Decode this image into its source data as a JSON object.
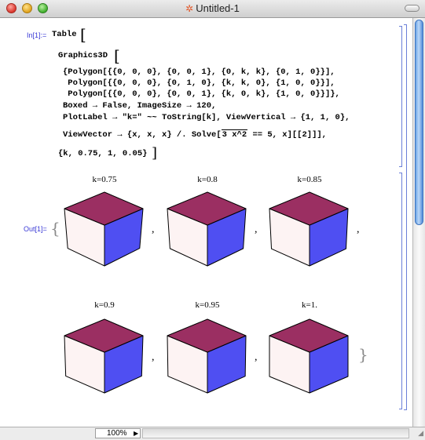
{
  "window": {
    "title": "Untitled-1"
  },
  "cells": {
    "input_label": "In[1]:=",
    "output_label": "Out[1]=",
    "code_lines": [
      "Table",
      "Graphics3D",
      "{Polygon[{{0, 0, 0}, {0, 0, 1}, {0, k, k}, {0, 1, 0}}],",
      " Polygon[{{0, 0, 0}, {0, 1, 0}, {k, k, 0}, {1, 0, 0}}],",
      " Polygon[{{0, 0, 0}, {0, 0, 1}, {k, 0, k}, {1, 0, 0}}]},",
      "Boxed → False, ImageSize → 120,",
      "PlotLabel → \"k=\" ~~ ToString[k], ViewVertical → {1, 1, 0},",
      "ViewVector → {x, x, x} /. Solve[",
      "3 x^2",
      " == 5, x][[2]]],",
      "{k, 0.75, 1, 0.05}"
    ]
  },
  "plots": [
    {
      "label": "k=0.75",
      "k": 0.75
    },
    {
      "label": "k=0.8",
      "k": 0.8
    },
    {
      "label": "k=0.85",
      "k": 0.85
    },
    {
      "label": "k=0.9",
      "k": 0.9
    },
    {
      "label": "k=0.95",
      "k": 0.95
    },
    {
      "label": "k=1.",
      "k": 1.0
    }
  ],
  "colors": {
    "top": "#9b2f62",
    "left": "#fdf3f3",
    "right": "#4f4ff2",
    "label_blue": "#3b3bd6"
  },
  "status": {
    "zoom": "100%"
  }
}
